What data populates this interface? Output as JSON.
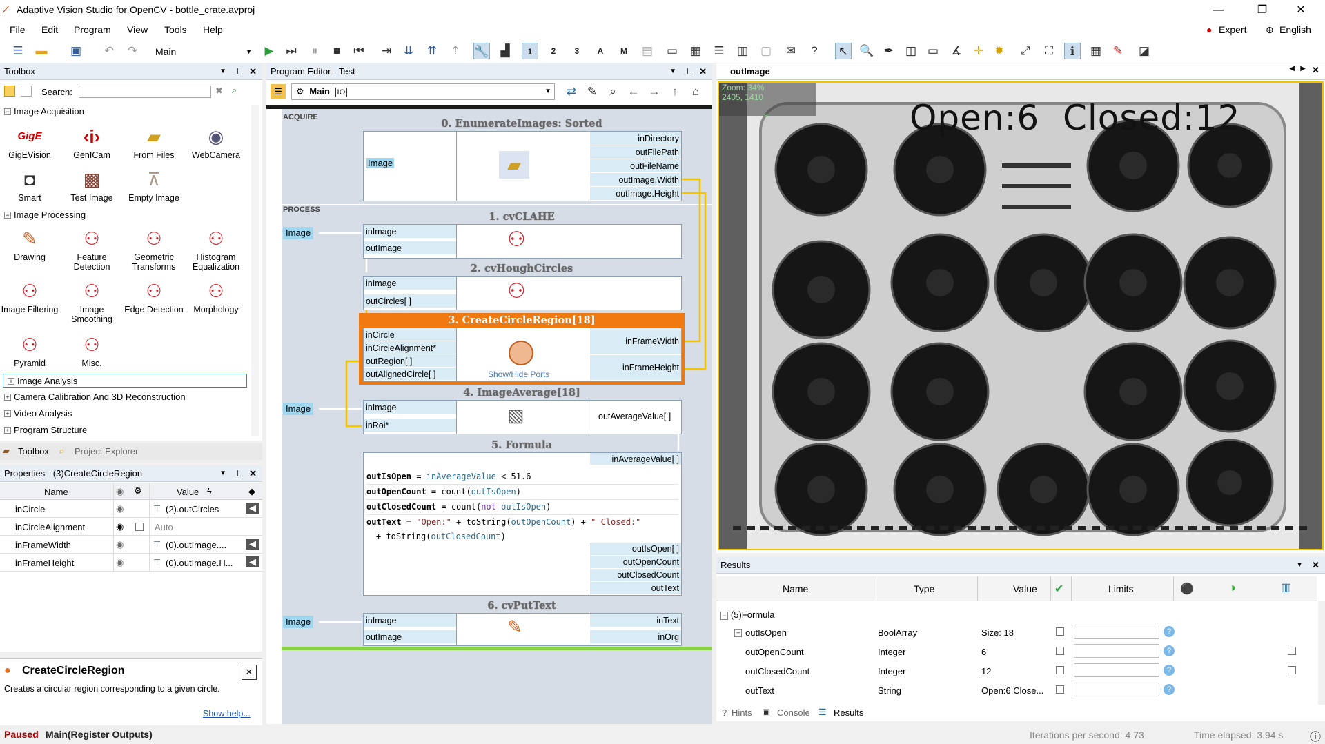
{
  "window": {
    "title": "Adaptive Vision Studio for OpenCV  - bottle_crate.avproj",
    "minimize": "—",
    "maximize": "❐",
    "close": "✕"
  },
  "menu": [
    "File",
    "Edit",
    "Program",
    "View",
    "Tools",
    "Help"
  ],
  "menu_right": {
    "expert": "Expert",
    "language": "English"
  },
  "toolbar": {
    "macro_select": "Main"
  },
  "toolbox": {
    "title": "Toolbox",
    "search_label": "Search:",
    "search_value": "",
    "sections": {
      "acquisition": "Image Acquisition",
      "processing": "Image Processing",
      "analysis": "Image Analysis",
      "calibration": "Camera Calibration And 3D Reconstruction",
      "video": "Video Analysis",
      "structure": "Program Structure"
    },
    "acq_tools": [
      "GigEVision",
      "GenICam",
      "From Files",
      "WebCamera",
      "Smart",
      "Test Image",
      "Empty Image"
    ],
    "proc_tools": [
      "Drawing",
      "Feature Detection",
      "Geometric Transforms",
      "Histogram Equalization",
      "Image Filtering",
      "Image Smoothing",
      "Edge Detection",
      "Morphology",
      "Pyramid",
      "Misc."
    ],
    "tabs": [
      "Toolbox",
      "Project Explorer"
    ]
  },
  "properties": {
    "title": "Properties - (3)CreateCircleRegion",
    "col_name": "Name",
    "col_value": "Value",
    "rows": [
      {
        "name": "inCircle",
        "value": "(2).outCircles"
      },
      {
        "name": "inCircleAlignment",
        "value": "Auto"
      },
      {
        "name": "inFrameWidth",
        "value": "(0).outImage...."
      },
      {
        "name": "inFrameHeight",
        "value": "(0).outImage.H..."
      }
    ]
  },
  "help": {
    "title": "CreateCircleRegion",
    "desc": "Creates a circular region corresponding to a given circle.",
    "link": "Show help..."
  },
  "editor": {
    "title": "Program Editor - Test",
    "macro": "Main",
    "io_badge": "IO",
    "sec_acquire": "ACQUIRE",
    "sec_process": "PROCESS",
    "image_tag": "Image",
    "nodes": {
      "n0": {
        "title": "0. EnumerateImages: Sorted",
        "in": [
          "Image"
        ],
        "out": [
          "inDirectory",
          "outFilePath",
          "outFileName",
          "outImage.Width",
          "outImage.Height"
        ]
      },
      "n1": {
        "title": "1. cvCLAHE",
        "in": [
          "inImage",
          "outImage"
        ]
      },
      "n2": {
        "title": "2. cvHoughCircles",
        "in": [
          "inImage",
          "outCircles[ ]"
        ]
      },
      "n3": {
        "title": "3. CreateCircleRegion[18]",
        "in": [
          "inCircle",
          "inCircleAlignment*",
          "outRegion[ ]",
          "outAlignedCircle[ ]"
        ],
        "out": [
          "inFrameWidth",
          "inFrameHeight"
        ],
        "show_hide": "Show/Hide Ports"
      },
      "n4": {
        "title": "4. ImageAverage[18]",
        "in": [
          "inImage",
          "inRoi*"
        ],
        "out": [
          "outAverageValue[ ]"
        ]
      },
      "n5": {
        "title": "5. Formula",
        "top_in": "inAverageValue[ ]",
        "out": [
          "outIsOpen[ ]",
          "outOpenCount",
          "outClosedCount",
          "outText"
        ]
      },
      "n6": {
        "title": "6. cvPutText",
        "in": [
          "inImage",
          "outImage"
        ],
        "out": [
          "inText",
          "inOrg"
        ]
      }
    },
    "formula": {
      "l1a": "outIsOpen",
      "l1b": " = ",
      "l1c": "inAverageValue",
      "l1d": " < 51.6",
      "l2a": "outOpenCount",
      "l2b": " = count(",
      "l2c": "outIsOpen",
      "l2d": ")",
      "l3a": "outClosedCount",
      "l3b": " = count(",
      "l3k": "not",
      "l3c": " outIsOpen",
      "l3d": ")",
      "l4a": "outText",
      "l4b": " = ",
      "l4s1": "\"Open:\"",
      "l4c": " + toString(",
      "l4d": "outOpenCount",
      "l4e": ") + ",
      "l4s2": "\" Closed:\"",
      "l5a": "+ toString(",
      "l5b": "outClosedCount",
      "l5c": ")"
    }
  },
  "viewer": {
    "tab": "outImage",
    "zoom": "Zoom: 34%",
    "coords": "2405, 1410",
    "overlay_text": "Open:6  Closed:12"
  },
  "results": {
    "title": "Results",
    "headers": [
      "Name",
      "Type",
      "Value",
      "Limits"
    ],
    "group": "(5)Formula",
    "rows": [
      {
        "name": "outIsOpen",
        "type": "BoolArray",
        "value": "Size: 18"
      },
      {
        "name": "outOpenCount",
        "type": "Integer",
        "value": "6"
      },
      {
        "name": "outClosedCount",
        "type": "Integer",
        "value": "12"
      },
      {
        "name": "outText",
        "type": "String",
        "value": "Open:6 Close..."
      }
    ],
    "tabs": [
      "Hints",
      "Console",
      "Results"
    ]
  },
  "status": {
    "state": "Paused",
    "location": "Main(Register Outputs)",
    "ips": "Iterations per second: 4.73",
    "elapsed": "Time elapsed: 3.94 s"
  }
}
